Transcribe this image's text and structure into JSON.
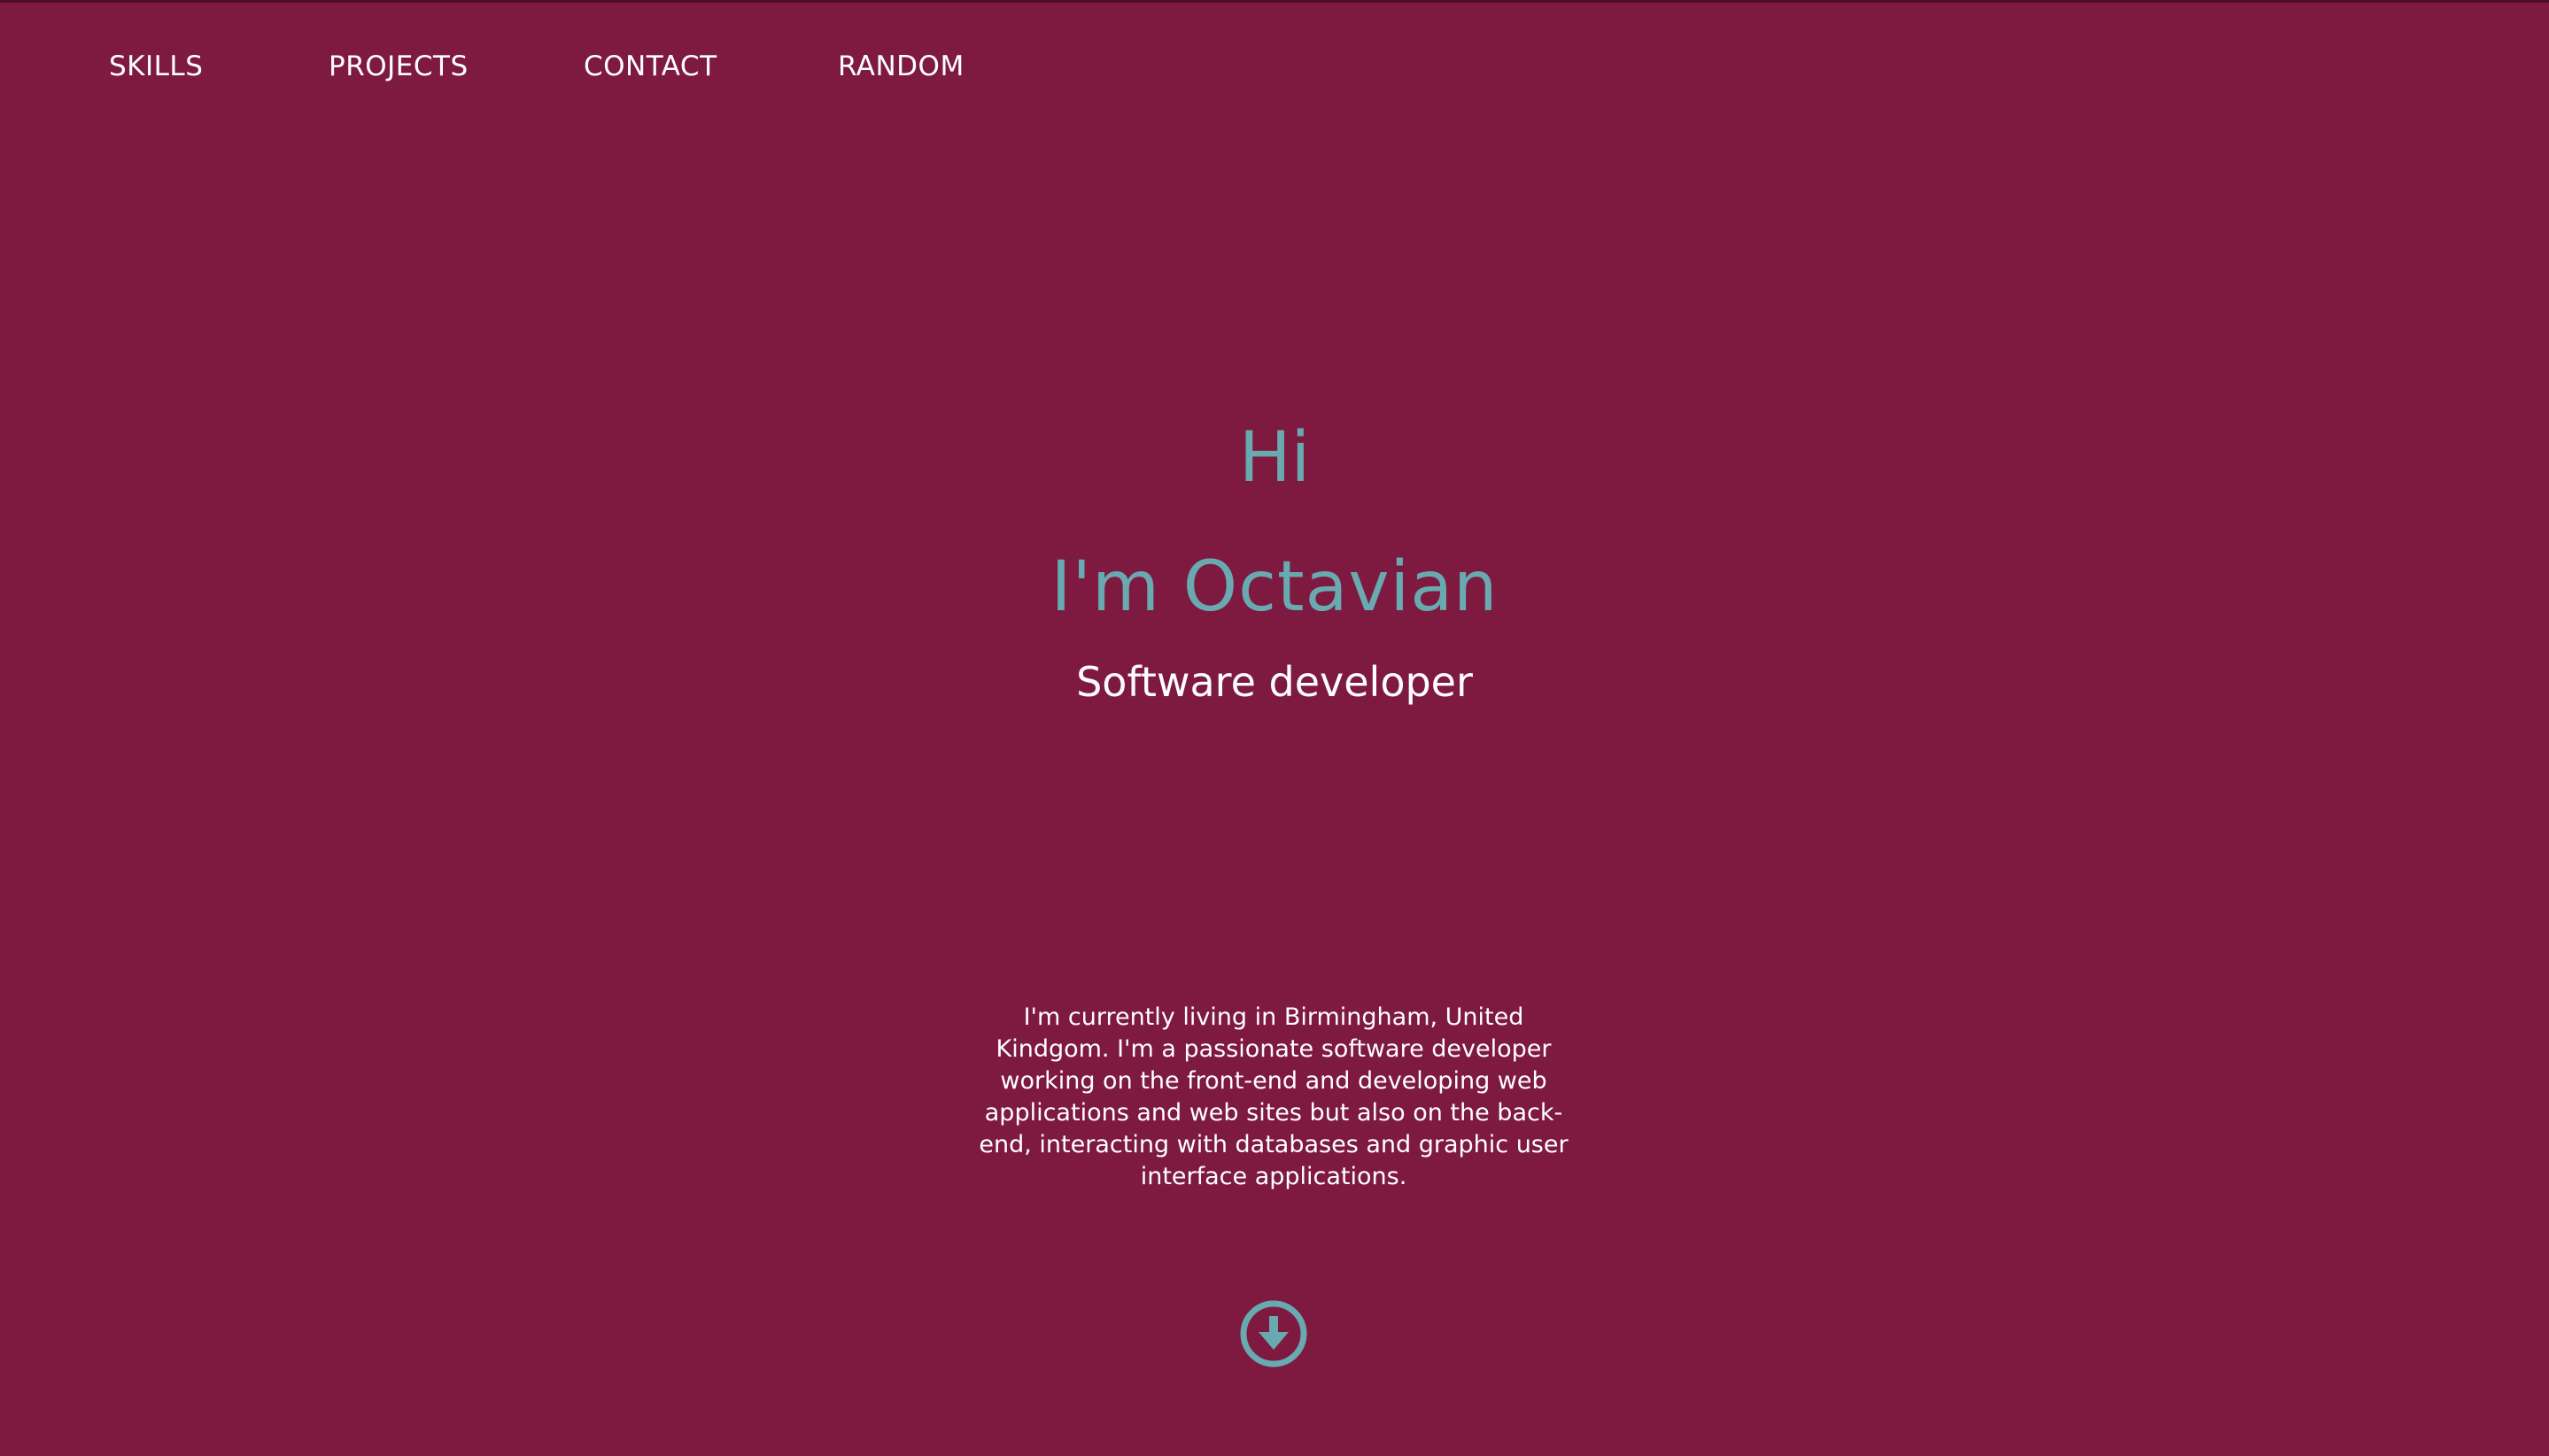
{
  "nav": {
    "items": [
      {
        "label": "SKILLS"
      },
      {
        "label": "PROJECTS"
      },
      {
        "label": "CONTACT"
      },
      {
        "label": "RANDOM"
      }
    ]
  },
  "hero": {
    "greeting": "Hi",
    "name": "I'm Octavian",
    "role": "Software developer"
  },
  "about": {
    "text": "I'm currently living in Birmingham, United Kindgom. I'm a passionate software developer working on the front-end and developing web applications and web sites but also on the back-end, interacting with databases and graphic user interface applications."
  },
  "scroll_button": {
    "icon": "arrow-circle-down-icon"
  },
  "colors": {
    "background": "#7e1940",
    "accent": "#68aab0",
    "text": "#ffffff"
  }
}
